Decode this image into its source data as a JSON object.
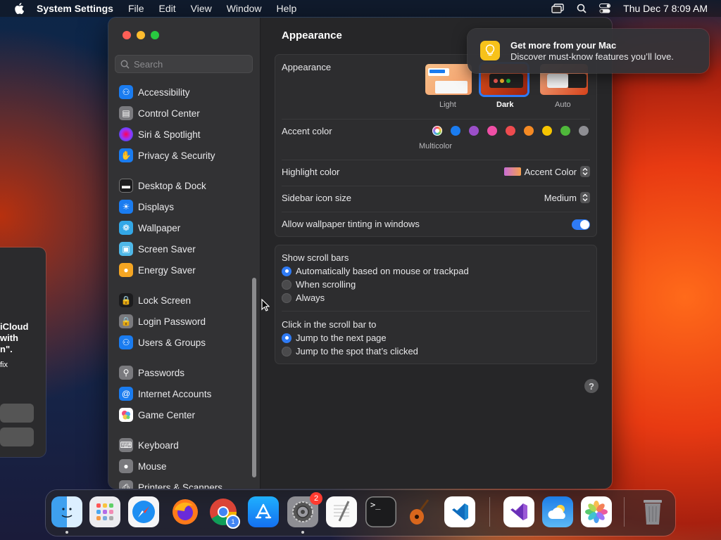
{
  "menubar": {
    "app_name": "System Settings",
    "menus": [
      "File",
      "Edit",
      "View",
      "Window",
      "Help"
    ],
    "clock": "Thu Dec 7  8:09 AM"
  },
  "back_window": {
    "line1": "iCloud",
    "line2": "with",
    "line3": "n\".",
    "line4": "fix"
  },
  "sidebar": {
    "search_placeholder": "Search",
    "items": [
      {
        "label": "Accessibility",
        "icon": "accessibility-icon",
        "color": "#1a7cf0"
      },
      {
        "label": "Control Center",
        "icon": "control-center-icon",
        "color": "#7a7a7e"
      },
      {
        "label": "Siri & Spotlight",
        "icon": "siri-icon",
        "color": "#b03ad6"
      },
      {
        "label": "Privacy & Security",
        "icon": "hand-icon",
        "color": "#1a7cf0"
      },
      {
        "label": "Desktop & Dock",
        "icon": "dock-icon",
        "color": "#1c1c1e"
      },
      {
        "label": "Displays",
        "icon": "sun-icon",
        "color": "#1a7cf0"
      },
      {
        "label": "Wallpaper",
        "icon": "wallpaper-icon",
        "color": "#33a7e6"
      },
      {
        "label": "Screen Saver",
        "icon": "screen-saver-icon",
        "color": "#4fb8e8"
      },
      {
        "label": "Energy Saver",
        "icon": "bulb-icon",
        "color": "#f5a623"
      },
      {
        "label": "Lock Screen",
        "icon": "lock-icon",
        "color": "#1c1c1e"
      },
      {
        "label": "Login Password",
        "icon": "padlock-icon",
        "color": "#7a7a7e"
      },
      {
        "label": "Users & Groups",
        "icon": "users-icon",
        "color": "#1a7cf0"
      },
      {
        "label": "Passwords",
        "icon": "key-icon",
        "color": "#7a7a7e"
      },
      {
        "label": "Internet Accounts",
        "icon": "at-icon",
        "color": "#1a7cf0"
      },
      {
        "label": "Game Center",
        "icon": "game-center-icon",
        "color": "#ffffff"
      },
      {
        "label": "Keyboard",
        "icon": "keyboard-icon",
        "color": "#7a7a7e"
      },
      {
        "label": "Mouse",
        "icon": "mouse-icon",
        "color": "#7a7a7e"
      },
      {
        "label": "Printers & Scanners",
        "icon": "printer-icon",
        "color": "#7a7a7e"
      }
    ]
  },
  "content": {
    "title": "Appearance",
    "appearance": {
      "label": "Appearance",
      "options": [
        "Light",
        "Dark",
        "Auto"
      ],
      "selected": "Dark"
    },
    "accent": {
      "label": "Accent color",
      "selected_caption": "Multicolor",
      "colors": [
        "#c86dd7",
        "#1a7cf0",
        "#9b4fc9",
        "#ef4fa6",
        "#ee4b4f",
        "#f58a24",
        "#f5c400",
        "#4fb83b",
        "#8e8e93"
      ]
    },
    "highlight": {
      "label": "Highlight color",
      "value": "Accent Color"
    },
    "sidebar_icon_size": {
      "label": "Sidebar icon size",
      "value": "Medium"
    },
    "wallpaper_tinting": {
      "label": "Allow wallpaper tinting in windows",
      "enabled": true
    },
    "scroll_bars": {
      "label": "Show scroll bars",
      "options": [
        "Automatically based on mouse or trackpad",
        "When scrolling",
        "Always"
      ],
      "selected": 0
    },
    "click_scroll": {
      "label": "Click in the scroll bar to",
      "options": [
        "Jump to the next page",
        "Jump to the spot that’s clicked"
      ],
      "selected": 0
    },
    "help": "?"
  },
  "notification": {
    "title": "Get more from your Mac",
    "body": "Discover must-know features you’ll love."
  },
  "dock": {
    "apps": [
      {
        "name": "Finder",
        "icon": "finder-icon",
        "running": true
      },
      {
        "name": "Launchpad",
        "icon": "launchpad-icon",
        "running": false
      },
      {
        "name": "Safari",
        "icon": "safari-icon",
        "running": false
      },
      {
        "name": "Firefox",
        "icon": "firefox-icon",
        "running": false
      },
      {
        "name": "Chrome",
        "icon": "chrome-icon",
        "running": false,
        "badge": "1"
      },
      {
        "name": "App Store",
        "icon": "app-store-icon",
        "running": false
      },
      {
        "name": "System Settings",
        "icon": "settings-gear-icon",
        "running": true,
        "badge": "2"
      },
      {
        "name": "TextEdit",
        "icon": "textedit-icon",
        "running": false
      },
      {
        "name": "Terminal",
        "icon": "terminal-icon",
        "running": false
      },
      {
        "name": "GarageBand",
        "icon": "guitar-icon",
        "running": false
      },
      {
        "name": "Visual Studio Code",
        "icon": "vscode-icon",
        "running": false
      },
      {
        "name": "Visual Studio",
        "icon": "visual-studio-icon",
        "running": false
      },
      {
        "name": "Weather",
        "icon": "weather-icon",
        "running": false
      },
      {
        "name": "Photos",
        "icon": "photos-icon",
        "running": false
      },
      {
        "name": "Trash",
        "icon": "trash-icon",
        "running": false
      }
    ]
  }
}
